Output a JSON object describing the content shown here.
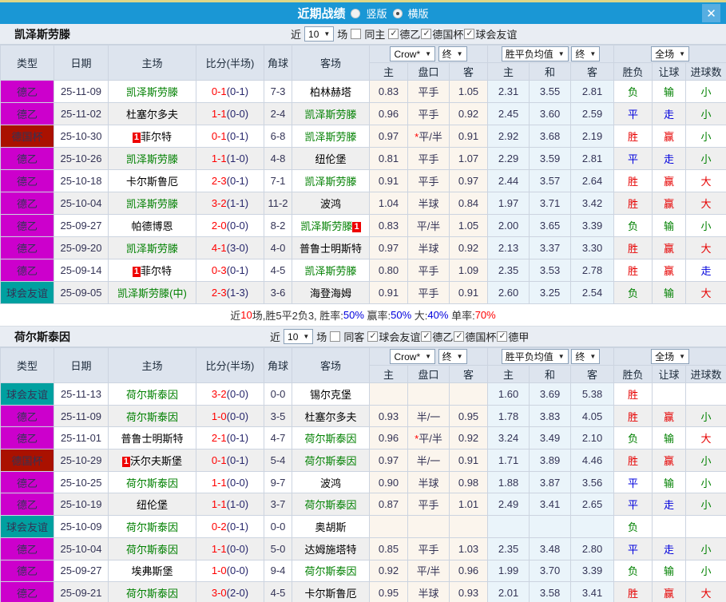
{
  "colors": {
    "titlebar_bg": "#1a97d5",
    "close_bg": "#57aee1",
    "header_bg": "#dde4ee",
    "team_header_bg": "#e9edf3",
    "row_alt_bg": "#efefef",
    "odds_col_bg": "#fbf5ed",
    "avg_col_bg": "#eaf4fa",
    "score_main": "#ff0000",
    "score_half": "#26266b",
    "team_green": "#008000",
    "win_red": "#e60000",
    "draw_blue": "#0000dd",
    "lose_green": "#008000"
  },
  "league_colors": {
    "德乙": "#cc00cc",
    "德国杯": "#aa1100",
    "球会友谊": "#00a0a0",
    "德甲": "#cc00cc"
  },
  "result_colors": {
    "胜": "#e60000",
    "赢": "#e60000",
    "大": "#e60000",
    "平": "#0000dd",
    "走": "#0000dd",
    "负": "#008000",
    "输": "#008000",
    "小": "#008000"
  },
  "titlebar": {
    "title": "近期战绩",
    "radio_vertical": "竖版",
    "radio_vertical_checked": false,
    "radio_horizontal": "横版",
    "radio_horizontal_checked": true,
    "close_label": "✕"
  },
  "filter_labels": {
    "near": "近",
    "count": "10",
    "games": "场"
  },
  "table_header": {
    "col_type": "类型",
    "col_date": "日期",
    "col_home": "主场",
    "col_score": "比分(半场)",
    "col_corner": "角球",
    "col_away": "客场",
    "odds_select": "Crow*",
    "odds_final": "终",
    "avg_select": "胜平负均值",
    "avg_final": "终",
    "full_select": "全场",
    "sub_odds_home": "主",
    "sub_odds_handicap": "盘口",
    "sub_odds_away": "客",
    "sub_avg_home": "主",
    "sub_avg_draw": "和",
    "sub_avg_away": "客",
    "sub_result": "胜负",
    "sub_handicap": "让球",
    "sub_goals": "进球数"
  },
  "tables": [
    {
      "team": "凯泽斯劳滕",
      "same_label": "同主",
      "same_checked": false,
      "leagues": [
        "德乙",
        "德国杯",
        "球会友谊"
      ],
      "rows": [
        {
          "lg": "德乙",
          "date": "25-11-09",
          "home": "凯泽斯劳滕",
          "hg": true,
          "hb": false,
          "score": "0-1",
          "half": "(0-1)",
          "corner": "7-3",
          "away": "柏林赫塔",
          "ag": false,
          "ab": false,
          "o1": "0.83",
          "hcap": "平手",
          "star": false,
          "o2": "1.05",
          "a1": "2.31",
          "a2": "3.55",
          "a3": "2.81",
          "r": "负",
          "hr": "输",
          "g": "小"
        },
        {
          "lg": "德乙",
          "date": "25-11-02",
          "home": "杜塞尔多夫",
          "hg": false,
          "hb": false,
          "score": "1-1",
          "half": "(0-0)",
          "corner": "2-4",
          "away": "凯泽斯劳滕",
          "ag": true,
          "ab": false,
          "o1": "0.96",
          "hcap": "平手",
          "star": false,
          "o2": "0.92",
          "a1": "2.45",
          "a2": "3.60",
          "a3": "2.59",
          "r": "平",
          "hr": "走",
          "g": "小"
        },
        {
          "lg": "德国杯",
          "date": "25-10-30",
          "home": "菲尔特",
          "hg": false,
          "hb": true,
          "score": "0-1",
          "half": "(0-1)",
          "corner": "6-8",
          "away": "凯泽斯劳滕",
          "ag": true,
          "ab": false,
          "o1": "0.97",
          "hcap": "平/半",
          "star": true,
          "o2": "0.91",
          "a1": "2.92",
          "a2": "3.68",
          "a3": "2.19",
          "r": "胜",
          "hr": "赢",
          "g": "小"
        },
        {
          "lg": "德乙",
          "date": "25-10-26",
          "home": "凯泽斯劳滕",
          "hg": true,
          "hb": false,
          "score": "1-1",
          "half": "(1-0)",
          "corner": "4-8",
          "away": "纽伦堡",
          "ag": false,
          "ab": false,
          "o1": "0.81",
          "hcap": "平手",
          "star": false,
          "o2": "1.07",
          "a1": "2.29",
          "a2": "3.59",
          "a3": "2.81",
          "r": "平",
          "hr": "走",
          "g": "小"
        },
        {
          "lg": "德乙",
          "date": "25-10-18",
          "home": "卡尔斯鲁厄",
          "hg": false,
          "hb": false,
          "score": "2-3",
          "half": "(0-1)",
          "corner": "7-1",
          "away": "凯泽斯劳滕",
          "ag": true,
          "ab": false,
          "o1": "0.91",
          "hcap": "平手",
          "star": false,
          "o2": "0.97",
          "a1": "2.44",
          "a2": "3.57",
          "a3": "2.64",
          "r": "胜",
          "hr": "赢",
          "g": "大"
        },
        {
          "lg": "德乙",
          "date": "25-10-04",
          "home": "凯泽斯劳滕",
          "hg": true,
          "hb": false,
          "score": "3-2",
          "half": "(1-1)",
          "corner": "11-2",
          "away": "波鸿",
          "ag": false,
          "ab": false,
          "o1": "1.04",
          "hcap": "半球",
          "star": false,
          "o2": "0.84",
          "a1": "1.97",
          "a2": "3.71",
          "a3": "3.42",
          "r": "胜",
          "hr": "赢",
          "g": "大"
        },
        {
          "lg": "德乙",
          "date": "25-09-27",
          "home": "帕德博恩",
          "hg": false,
          "hb": false,
          "score": "2-0",
          "half": "(0-0)",
          "corner": "8-2",
          "away": "凯泽斯劳滕",
          "ag": true,
          "ab": true,
          "o1": "0.83",
          "hcap": "平/半",
          "star": false,
          "o2": "1.05",
          "a1": "2.00",
          "a2": "3.65",
          "a3": "3.39",
          "r": "负",
          "hr": "输",
          "g": "小"
        },
        {
          "lg": "德乙",
          "date": "25-09-20",
          "home": "凯泽斯劳滕",
          "hg": true,
          "hb": false,
          "score": "4-1",
          "half": "(3-0)",
          "corner": "4-0",
          "away": "普鲁士明斯特",
          "ag": false,
          "ab": false,
          "o1": "0.97",
          "hcap": "半球",
          "star": false,
          "o2": "0.92",
          "a1": "2.13",
          "a2": "3.37",
          "a3": "3.30",
          "r": "胜",
          "hr": "赢",
          "g": "大"
        },
        {
          "lg": "德乙",
          "date": "25-09-14",
          "home": "菲尔特",
          "hg": false,
          "hb": true,
          "score": "0-3",
          "half": "(0-1)",
          "corner": "4-5",
          "away": "凯泽斯劳滕",
          "ag": true,
          "ab": false,
          "o1": "0.80",
          "hcap": "平手",
          "star": false,
          "o2": "1.09",
          "a1": "2.35",
          "a2": "3.53",
          "a3": "2.78",
          "r": "胜",
          "hr": "赢",
          "g": "走"
        },
        {
          "lg": "球会友谊",
          "date": "25-09-05",
          "home": "凯泽斯劳滕(中)",
          "hg": true,
          "hb": false,
          "score": "2-3",
          "half": "(1-3)",
          "corner": "3-6",
          "away": "海登海姆",
          "ag": false,
          "ab": false,
          "o1": "0.91",
          "hcap": "平手",
          "star": false,
          "o2": "0.91",
          "a1": "2.60",
          "a2": "3.25",
          "a3": "2.54",
          "r": "负",
          "hr": "输",
          "g": "大"
        }
      ],
      "summary": [
        {
          "t": "近",
          "c": "#333333"
        },
        {
          "t": "10",
          "c": "#ff0000"
        },
        {
          "t": "场,胜5平2负3, 胜率:",
          "c": "#333333"
        },
        {
          "t": "50%",
          "c": "#0000dd"
        },
        {
          "t": " 赢率:",
          "c": "#333333"
        },
        {
          "t": "50%",
          "c": "#0000dd"
        },
        {
          "t": " 大:",
          "c": "#333333"
        },
        {
          "t": "40%",
          "c": "#0000dd"
        },
        {
          "t": " 单率:",
          "c": "#333333"
        },
        {
          "t": "70%",
          "c": "#ff0000"
        }
      ]
    },
    {
      "team": "荷尔斯泰因",
      "same_label": "同客",
      "same_checked": false,
      "leagues": [
        "球会友谊",
        "德乙",
        "德国杯",
        "德甲"
      ],
      "rows": [
        {
          "lg": "球会友谊",
          "date": "25-11-13",
          "home": "荷尔斯泰因",
          "hg": true,
          "hb": false,
          "score": "3-2",
          "half": "(0-0)",
          "corner": "0-0",
          "away": "锡尔克堡",
          "ag": false,
          "ab": false,
          "o1": "",
          "hcap": "",
          "star": false,
          "o2": "",
          "a1": "1.60",
          "a2": "3.69",
          "a3": "5.38",
          "r": "胜",
          "hr": "",
          "g": ""
        },
        {
          "lg": "德乙",
          "date": "25-11-09",
          "home": "荷尔斯泰因",
          "hg": true,
          "hb": false,
          "score": "1-0",
          "half": "(0-0)",
          "corner": "3-5",
          "away": "杜塞尔多夫",
          "ag": false,
          "ab": false,
          "o1": "0.93",
          "hcap": "半/一",
          "star": false,
          "o2": "0.95",
          "a1": "1.78",
          "a2": "3.83",
          "a3": "4.05",
          "r": "胜",
          "hr": "赢",
          "g": "小"
        },
        {
          "lg": "德乙",
          "date": "25-11-01",
          "home": "普鲁士明斯特",
          "hg": false,
          "hb": false,
          "score": "2-1",
          "half": "(0-1)",
          "corner": "4-7",
          "away": "荷尔斯泰因",
          "ag": true,
          "ab": false,
          "o1": "0.96",
          "hcap": "平/半",
          "star": true,
          "o2": "0.92",
          "a1": "3.24",
          "a2": "3.49",
          "a3": "2.10",
          "r": "负",
          "hr": "输",
          "g": "大"
        },
        {
          "lg": "德国杯",
          "date": "25-10-29",
          "home": "沃尔夫斯堡",
          "hg": false,
          "hb": true,
          "score": "0-1",
          "half": "(0-1)",
          "corner": "5-4",
          "away": "荷尔斯泰因",
          "ag": true,
          "ab": false,
          "o1": "0.97",
          "hcap": "半/一",
          "star": false,
          "o2": "0.91",
          "a1": "1.71",
          "a2": "3.89",
          "a3": "4.46",
          "r": "胜",
          "hr": "赢",
          "g": "小"
        },
        {
          "lg": "德乙",
          "date": "25-10-25",
          "home": "荷尔斯泰因",
          "hg": true,
          "hb": false,
          "score": "1-1",
          "half": "(0-0)",
          "corner": "9-7",
          "away": "波鸿",
          "ag": false,
          "ab": false,
          "o1": "0.90",
          "hcap": "半球",
          "star": false,
          "o2": "0.98",
          "a1": "1.88",
          "a2": "3.87",
          "a3": "3.56",
          "r": "平",
          "hr": "输",
          "g": "小"
        },
        {
          "lg": "德乙",
          "date": "25-10-19",
          "home": "纽伦堡",
          "hg": false,
          "hb": false,
          "score": "1-1",
          "half": "(1-0)",
          "corner": "3-7",
          "away": "荷尔斯泰因",
          "ag": true,
          "ab": false,
          "o1": "0.87",
          "hcap": "平手",
          "star": false,
          "o2": "1.01",
          "a1": "2.49",
          "a2": "3.41",
          "a3": "2.65",
          "r": "平",
          "hr": "走",
          "g": "小"
        },
        {
          "lg": "球会友谊",
          "date": "25-10-09",
          "home": "荷尔斯泰因",
          "hg": true,
          "hb": false,
          "score": "0-2",
          "half": "(0-1)",
          "corner": "0-0",
          "away": "奥胡斯",
          "ag": false,
          "ab": false,
          "o1": "",
          "hcap": "",
          "star": false,
          "o2": "",
          "a1": "",
          "a2": "",
          "a3": "",
          "r": "负",
          "hr": "",
          "g": ""
        },
        {
          "lg": "德乙",
          "date": "25-10-04",
          "home": "荷尔斯泰因",
          "hg": true,
          "hb": false,
          "score": "1-1",
          "half": "(0-0)",
          "corner": "5-0",
          "away": "达姆施塔特",
          "ag": false,
          "ab": false,
          "o1": "0.85",
          "hcap": "平手",
          "star": false,
          "o2": "1.03",
          "a1": "2.35",
          "a2": "3.48",
          "a3": "2.80",
          "r": "平",
          "hr": "走",
          "g": "小"
        },
        {
          "lg": "德乙",
          "date": "25-09-27",
          "home": "埃弗斯堡",
          "hg": false,
          "hb": false,
          "score": "1-0",
          "half": "(0-0)",
          "corner": "9-4",
          "away": "荷尔斯泰因",
          "ag": true,
          "ab": false,
          "o1": "0.92",
          "hcap": "平/半",
          "star": false,
          "o2": "0.96",
          "a1": "1.99",
          "a2": "3.70",
          "a3": "3.39",
          "r": "负",
          "hr": "输",
          "g": "小"
        },
        {
          "lg": "德乙",
          "date": "25-09-21",
          "home": "荷尔斯泰因",
          "hg": true,
          "hb": false,
          "score": "3-0",
          "half": "(2-0)",
          "corner": "4-5",
          "away": "卡尔斯鲁厄",
          "ag": false,
          "ab": false,
          "o1": "0.95",
          "hcap": "半球",
          "star": false,
          "o2": "0.93",
          "a1": "2.01",
          "a2": "3.58",
          "a3": "3.41",
          "r": "胜",
          "hr": "赢",
          "g": "大"
        }
      ],
      "summary": null
    }
  ]
}
